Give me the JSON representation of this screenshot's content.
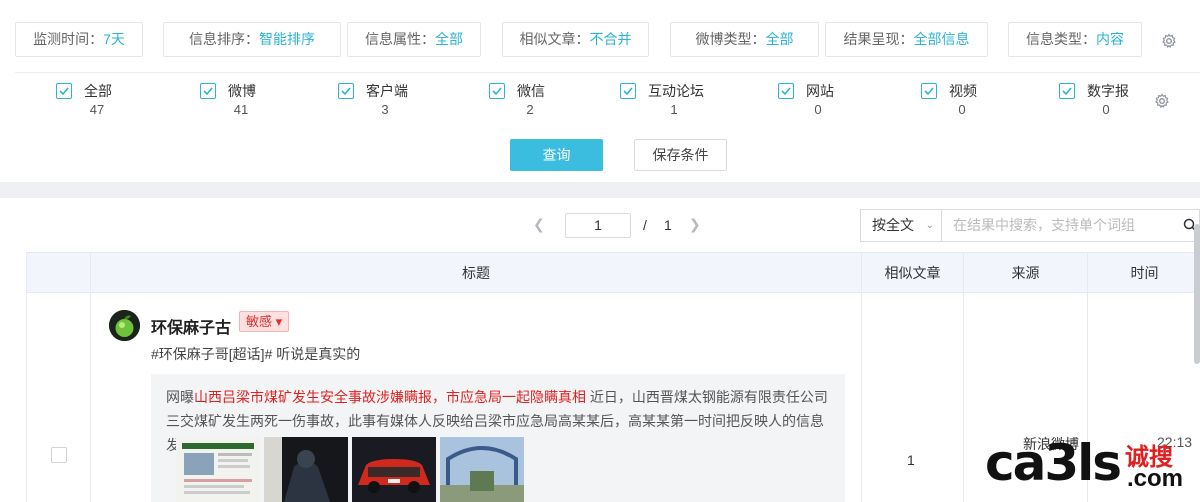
{
  "filters": [
    {
      "label": "监测时间：",
      "value": "7天"
    },
    {
      "label": "信息排序：",
      "value": "智能排序"
    },
    {
      "label": "信息属性：",
      "value": "全部"
    },
    {
      "label": "相似文章：",
      "value": "不合并"
    },
    {
      "label": "微博类型：",
      "value": "全部"
    },
    {
      "label": "结果呈现：",
      "value": "全部信息"
    },
    {
      "label": "信息类型：",
      "value": "内容"
    }
  ],
  "source_types": [
    {
      "label": "全部",
      "count": "47"
    },
    {
      "label": "微博",
      "count": "41"
    },
    {
      "label": "客户端",
      "count": "3"
    },
    {
      "label": "微信",
      "count": "2"
    },
    {
      "label": "互动论坛",
      "count": "1"
    },
    {
      "label": "网站",
      "count": "0"
    },
    {
      "label": "视频",
      "count": "0"
    },
    {
      "label": "数字报",
      "count": "0"
    }
  ],
  "actions": {
    "query": "查询",
    "save": "保存条件"
  },
  "pager": {
    "current": "1",
    "sep": "/",
    "total": "1"
  },
  "search": {
    "mode": "按全文",
    "placeholder": "在结果中搜索，支持单个词组"
  },
  "table": {
    "headers": {
      "title": "标题",
      "similar": "相似文章",
      "source": "来源",
      "time": "时间"
    }
  },
  "post": {
    "author": "环保麻子古",
    "tag": "敏感",
    "text": "#环保麻子哥[超话]# 听说是真实的",
    "repost_prefix": "网曝",
    "repost_highlight": "山西吕梁市煤矿发生安全事故涉嫌瞒报，市应急局一起隐瞒真相",
    "repost_body": " 近日，山西晋煤太钢能源有限责任公司三交煤矿发生两死一伤事故，此事有媒体人反映给吕梁市应急局高某某后，高某某第一时间把反映人的信息发给煤...",
    "similar_count": "1",
    "source": "新浪微博",
    "time": "22:13"
  },
  "watermark": {
    "main": "ca3ls",
    "cn": "诚搜",
    "com": ".com"
  },
  "colors": {
    "accent": "#3bbde0",
    "sensitive": "#e02020",
    "header_bg": "#f2f6fc"
  }
}
